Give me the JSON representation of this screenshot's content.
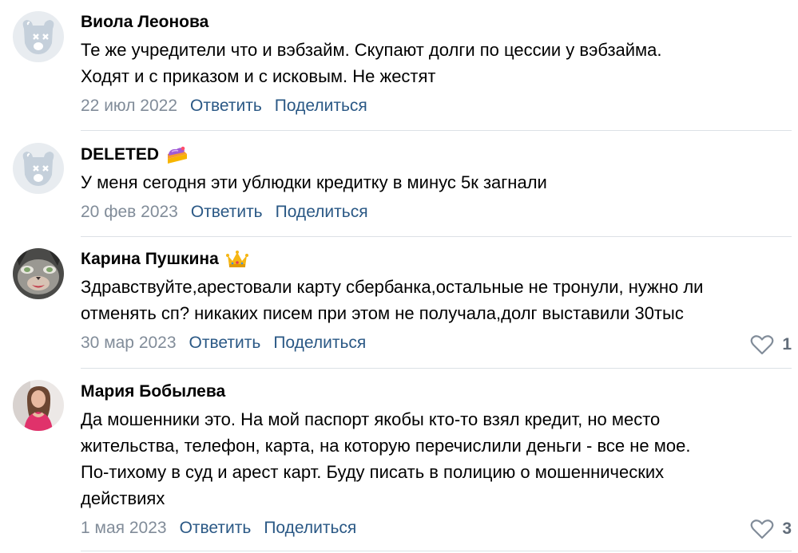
{
  "colors": {
    "text": "#000000",
    "meta": "#818c99",
    "link": "#2a5885",
    "divider": "#dce1e6",
    "like": "#626d7a"
  },
  "comments": [
    {
      "author": "Виола Леонова",
      "avatar": "deleted-dog-avatar",
      "text": "Те же учредители что и вэбзайм. Скупают долги по цессии у вэбзайма.\nХодят и с приказом и с исковым. Не жестят",
      "date": "22 июл 2022",
      "reply": "Ответить",
      "share": "Поделиться"
    },
    {
      "author": "DELETED",
      "avatar": "deleted-dog-avatar",
      "badge": "cake-icon",
      "text": "У меня сегодня эти ублюдки кредитку в минус 5к загнали",
      "date": "20 фев 2023",
      "reply": "Ответить",
      "share": "Поделиться"
    },
    {
      "author": "Карина Пушкина",
      "avatar": "cat-face-avatar",
      "badge": "crown-icon",
      "text": "Здравствуйте,арестовали карту сбербанка,остальные не тронули, нужно ли\nотменять сп? никаких писем при этом не получала,долг выставили 30тыс",
      "date": "30 мар 2023",
      "reply": "Ответить",
      "share": "Поделиться",
      "likes": "1"
    },
    {
      "author": "Мария Бобылева",
      "avatar": "woman-photo-avatar",
      "text": "Да мошенники это. На мой паспорт якобы кто-то взял кредит, но место\nжительства, телефон, карта, на которую перечислили деньги - все не мое.\nПо-тихому в суд и арест карт. Буду писать в полицию о мошеннических\nдействиях",
      "date": "1 мая 2023",
      "reply": "Ответить",
      "share": "Поделиться",
      "likes": "3"
    }
  ]
}
